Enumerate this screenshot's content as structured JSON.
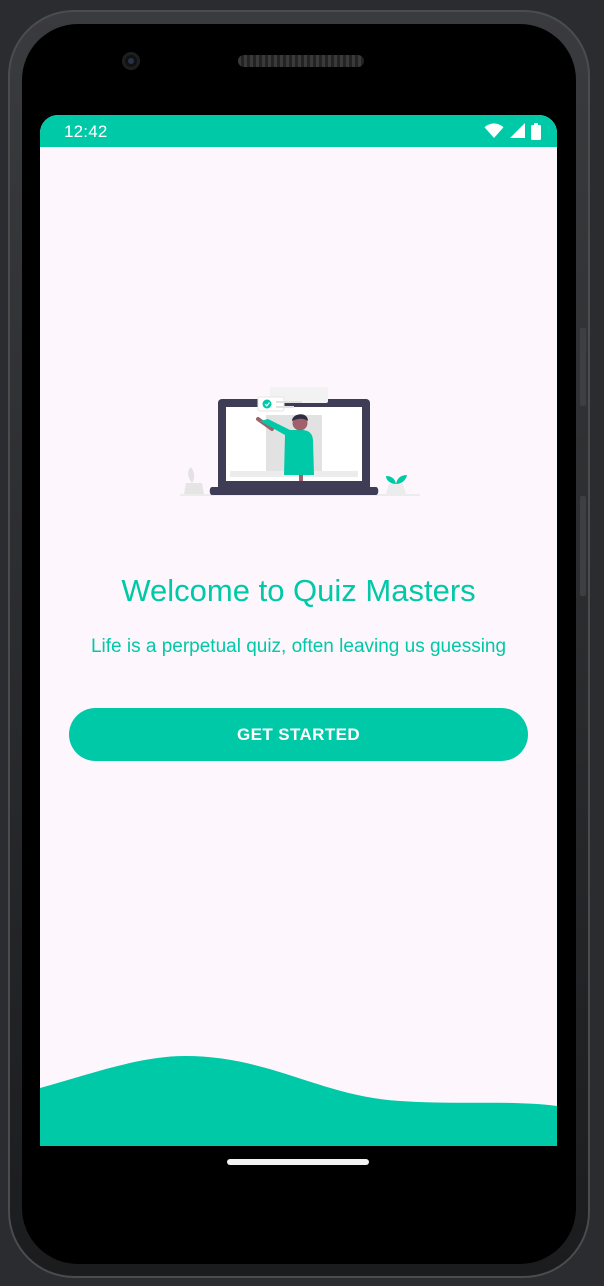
{
  "status_bar": {
    "time": "12:42",
    "icons": [
      "wifi-icon",
      "cellular-signal-icon",
      "battery-icon"
    ]
  },
  "welcome": {
    "title": "Welcome to Quiz Masters",
    "subtitle": "Life is a perpetual quiz, often leaving us guessing",
    "button_label": "GET STARTED"
  },
  "illustration": {
    "name": "person-at-laptop-illustration"
  },
  "colors": {
    "accent": "#00c9a7",
    "background": "#fdf6fd",
    "laptop_frame": "#3f3d56"
  }
}
